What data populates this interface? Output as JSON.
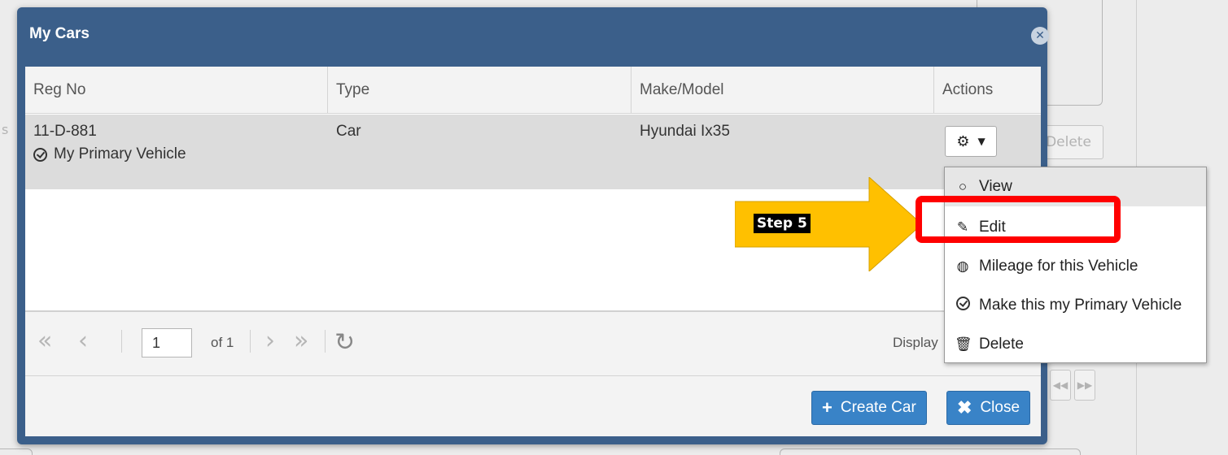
{
  "modal": {
    "title": "My Cars",
    "columns": [
      "Reg No",
      "Type",
      "Make/Model",
      "Actions"
    ],
    "rows": [
      {
        "reg_no": "11-D-881",
        "primary_label": "My Primary Vehicle",
        "type": "Car",
        "make_model": "Hyundai Ix35"
      }
    ],
    "pager": {
      "page_value": "1",
      "of_text": "of 1",
      "display_text": "Display"
    },
    "buttons": {
      "create": "Create Car",
      "close": "Close"
    }
  },
  "menu": {
    "items": [
      {
        "label": "View",
        "icon": "search-icon"
      },
      {
        "label": "Edit",
        "icon": "pencil-icon"
      },
      {
        "label": "Mileage for this Vehicle",
        "icon": "dashboard-icon"
      },
      {
        "label": "Make this my Primary Vehicle",
        "icon": "check-circle-icon"
      },
      {
        "label": "Delete",
        "icon": "trash-icon"
      }
    ]
  },
  "annotation": {
    "step": "Step 5",
    "arrow_color": "#ffc000",
    "highlight_color": "#ff0000"
  },
  "background": {
    "delete_label": "Delete"
  },
  "colors": {
    "header": "#3b5f8a",
    "button": "#3983c7",
    "row_selected": "#dcdcdc"
  }
}
